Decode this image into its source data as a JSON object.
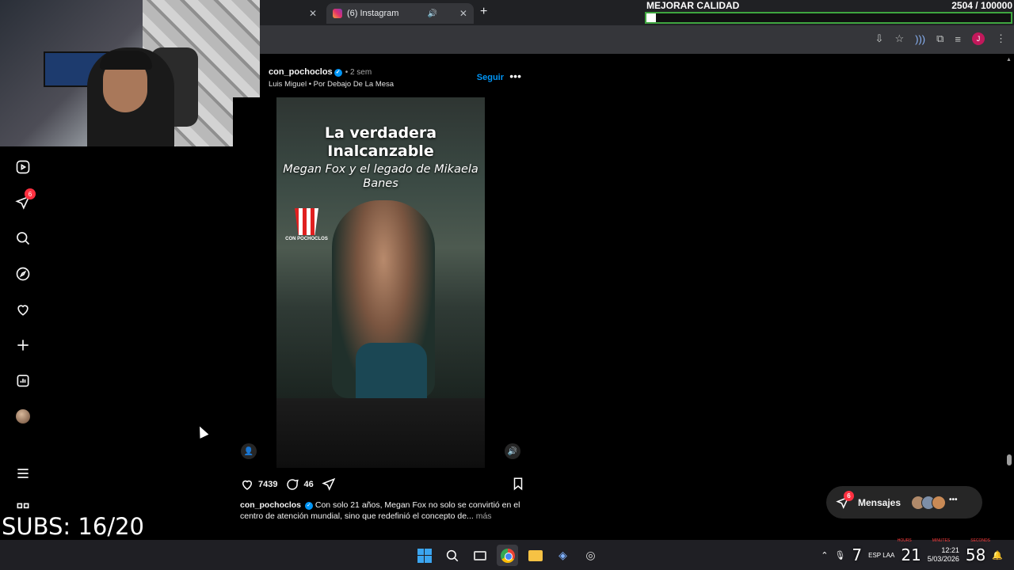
{
  "browser": {
    "tabs": [
      {
        "label": "",
        "close": "✕"
      },
      {
        "label": "(6) Instagram",
        "close": "✕"
      }
    ],
    "new_tab": "+",
    "profile_initial": "J"
  },
  "overlay": {
    "goal_title": "MEJORAR CALIDAD",
    "goal_count": "2504 / 100000",
    "goal_progress": 0.025,
    "subs": "SUBS: 16/20"
  },
  "nav": {
    "messages_badge": "6"
  },
  "post": {
    "username": "con_pochoclos",
    "time": "• 2 sem",
    "audio": "Luis Miguel • Por Debajo De La Mesa",
    "follow": "Seguir",
    "video_title": "La verdadera Inalcanzable",
    "video_subtitle": "Megan Fox y el legado de Mikaela Banes",
    "logo_text": "CON POCHOCLOS",
    "likes": "7439",
    "comments": "46",
    "caption_user": "con_pochoclos",
    "caption_text": "Con solo 21 años, Megan Fox no solo se convirtió en el centro de atención mundial, sino que redefinió el concepto de...",
    "caption_more": "más"
  },
  "messages": {
    "label": "Mensajes",
    "badge": "6"
  },
  "taskbar": {
    "timer_hours": "7",
    "timer_minutes": "21",
    "timer_seconds": "58",
    "timer_labels": [
      "HOURS",
      "MINUTES",
      "SECONDS"
    ],
    "lang": "ESP LAA",
    "time": "12:21",
    "date": "5/03/2026"
  }
}
